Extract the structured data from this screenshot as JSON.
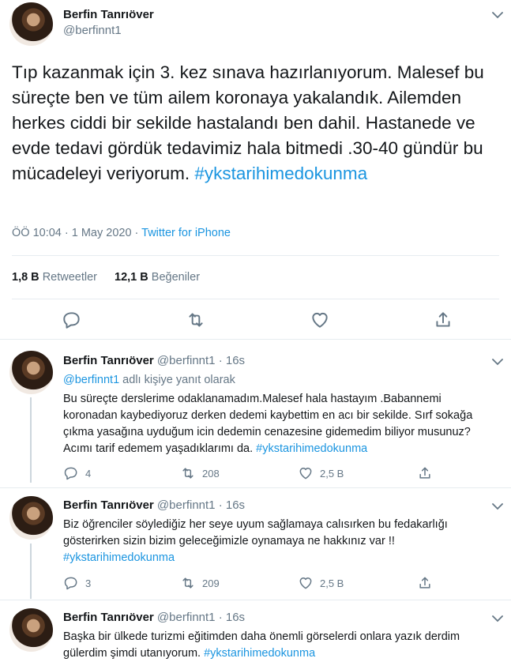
{
  "main_tweet": {
    "name": "Berfin Tanrıöver",
    "handle": "@berfinnt1",
    "text": "Tıp kazanmak için 3. kez sınava hazırlanıyorum. Malesef bu süreçte ben ve tüm ailem koronaya yakalandık. Ailemden herkes ciddi bir sekilde hastalandı ben dahil. Hastanede ve evde tedavi gördük tedavimiz hala bitmedi .30-40 gündür bu mücadeleyi veriyorum.",
    "hashtag": "#ykstarihimedokunma",
    "time": "ÖÖ 10:04 · 1 May 2020 · ",
    "source": "Twitter for iPhone",
    "retweets_count": "1,8 B",
    "retweets_label": "Retweetler",
    "likes_count": "12,1 B",
    "likes_label": "Beğeniler"
  },
  "replies": [
    {
      "name": "Berfin Tanrıöver",
      "handle": "@berfinnt1",
      "time": "16s",
      "reply_to_handle": "@berfinnt1",
      "reply_to_suffix": " adlı kişiye yanıt olarak",
      "text": "Bu süreçte derslerime odaklanamadım.Malesef hala hastayım .Babannemi koronadan kaybediyoruz derken dedemi kaybettim en acı bir  sekilde. Sırf sokağa çıkma yasağına uyduğum icin dedemin cenazesine gidemedim biliyor musunuz? Acımı tarif edemem yaşadıklarımı da. ",
      "hashtag": "#ykstarihimedokunma",
      "replies_count": "4",
      "retweets_count": "208",
      "likes_count": "2,5 B"
    },
    {
      "name": "Berfin Tanrıöver",
      "handle": "@berfinnt1",
      "time": "16s",
      "text": "Biz öğrenciler söylediğiz her seye uyum sağlamaya calısırken bu fedakarlığı gösterirken sizin bizim geleceğimizle oynamaya ne hakkınız var !!",
      "hashtag": "#ykstarihimedokunma",
      "replies_count": "3",
      "retweets_count": "209",
      "likes_count": "2,5 B"
    },
    {
      "name": "Berfin Tanrıöver",
      "handle": "@berfinnt1",
      "time": "16s",
      "text": "Başka bir ülkede turizmi eğitimden daha önemli görselerdi onlara yazık derdim gülerdim şimdi utanıyorum. ",
      "hashtag": "#ykstarihimedokunma"
    }
  ],
  "header_separator": " · "
}
